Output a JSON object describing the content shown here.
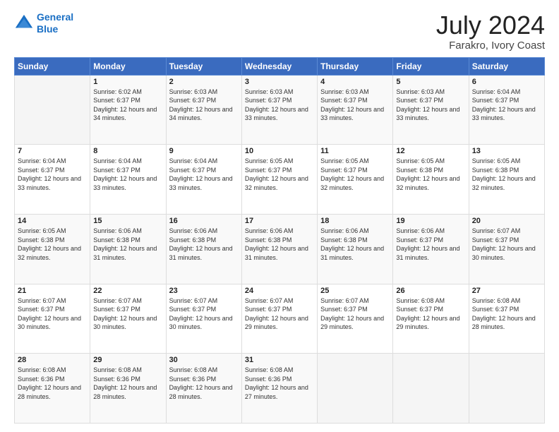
{
  "header": {
    "logo_line1": "General",
    "logo_line2": "Blue",
    "title": "July 2024",
    "subtitle": "Farakro, Ivory Coast"
  },
  "days_of_week": [
    "Sunday",
    "Monday",
    "Tuesday",
    "Wednesday",
    "Thursday",
    "Friday",
    "Saturday"
  ],
  "weeks": [
    [
      {
        "day": "",
        "sunrise": "",
        "sunset": "",
        "daylight": ""
      },
      {
        "day": "1",
        "sunrise": "Sunrise: 6:02 AM",
        "sunset": "Sunset: 6:37 PM",
        "daylight": "Daylight: 12 hours and 34 minutes."
      },
      {
        "day": "2",
        "sunrise": "Sunrise: 6:03 AM",
        "sunset": "Sunset: 6:37 PM",
        "daylight": "Daylight: 12 hours and 34 minutes."
      },
      {
        "day": "3",
        "sunrise": "Sunrise: 6:03 AM",
        "sunset": "Sunset: 6:37 PM",
        "daylight": "Daylight: 12 hours and 33 minutes."
      },
      {
        "day": "4",
        "sunrise": "Sunrise: 6:03 AM",
        "sunset": "Sunset: 6:37 PM",
        "daylight": "Daylight: 12 hours and 33 minutes."
      },
      {
        "day": "5",
        "sunrise": "Sunrise: 6:03 AM",
        "sunset": "Sunset: 6:37 PM",
        "daylight": "Daylight: 12 hours and 33 minutes."
      },
      {
        "day": "6",
        "sunrise": "Sunrise: 6:04 AM",
        "sunset": "Sunset: 6:37 PM",
        "daylight": "Daylight: 12 hours and 33 minutes."
      }
    ],
    [
      {
        "day": "7",
        "sunrise": "Sunrise: 6:04 AM",
        "sunset": "Sunset: 6:37 PM",
        "daylight": "Daylight: 12 hours and 33 minutes."
      },
      {
        "day": "8",
        "sunrise": "Sunrise: 6:04 AM",
        "sunset": "Sunset: 6:37 PM",
        "daylight": "Daylight: 12 hours and 33 minutes."
      },
      {
        "day": "9",
        "sunrise": "Sunrise: 6:04 AM",
        "sunset": "Sunset: 6:37 PM",
        "daylight": "Daylight: 12 hours and 33 minutes."
      },
      {
        "day": "10",
        "sunrise": "Sunrise: 6:05 AM",
        "sunset": "Sunset: 6:37 PM",
        "daylight": "Daylight: 12 hours and 32 minutes."
      },
      {
        "day": "11",
        "sunrise": "Sunrise: 6:05 AM",
        "sunset": "Sunset: 6:37 PM",
        "daylight": "Daylight: 12 hours and 32 minutes."
      },
      {
        "day": "12",
        "sunrise": "Sunrise: 6:05 AM",
        "sunset": "Sunset: 6:38 PM",
        "daylight": "Daylight: 12 hours and 32 minutes."
      },
      {
        "day": "13",
        "sunrise": "Sunrise: 6:05 AM",
        "sunset": "Sunset: 6:38 PM",
        "daylight": "Daylight: 12 hours and 32 minutes."
      }
    ],
    [
      {
        "day": "14",
        "sunrise": "Sunrise: 6:05 AM",
        "sunset": "Sunset: 6:38 PM",
        "daylight": "Daylight: 12 hours and 32 minutes."
      },
      {
        "day": "15",
        "sunrise": "Sunrise: 6:06 AM",
        "sunset": "Sunset: 6:38 PM",
        "daylight": "Daylight: 12 hours and 31 minutes."
      },
      {
        "day": "16",
        "sunrise": "Sunrise: 6:06 AM",
        "sunset": "Sunset: 6:38 PM",
        "daylight": "Daylight: 12 hours and 31 minutes."
      },
      {
        "day": "17",
        "sunrise": "Sunrise: 6:06 AM",
        "sunset": "Sunset: 6:38 PM",
        "daylight": "Daylight: 12 hours and 31 minutes."
      },
      {
        "day": "18",
        "sunrise": "Sunrise: 6:06 AM",
        "sunset": "Sunset: 6:38 PM",
        "daylight": "Daylight: 12 hours and 31 minutes."
      },
      {
        "day": "19",
        "sunrise": "Sunrise: 6:06 AM",
        "sunset": "Sunset: 6:37 PM",
        "daylight": "Daylight: 12 hours and 31 minutes."
      },
      {
        "day": "20",
        "sunrise": "Sunrise: 6:07 AM",
        "sunset": "Sunset: 6:37 PM",
        "daylight": "Daylight: 12 hours and 30 minutes."
      }
    ],
    [
      {
        "day": "21",
        "sunrise": "Sunrise: 6:07 AM",
        "sunset": "Sunset: 6:37 PM",
        "daylight": "Daylight: 12 hours and 30 minutes."
      },
      {
        "day": "22",
        "sunrise": "Sunrise: 6:07 AM",
        "sunset": "Sunset: 6:37 PM",
        "daylight": "Daylight: 12 hours and 30 minutes."
      },
      {
        "day": "23",
        "sunrise": "Sunrise: 6:07 AM",
        "sunset": "Sunset: 6:37 PM",
        "daylight": "Daylight: 12 hours and 30 minutes."
      },
      {
        "day": "24",
        "sunrise": "Sunrise: 6:07 AM",
        "sunset": "Sunset: 6:37 PM",
        "daylight": "Daylight: 12 hours and 29 minutes."
      },
      {
        "day": "25",
        "sunrise": "Sunrise: 6:07 AM",
        "sunset": "Sunset: 6:37 PM",
        "daylight": "Daylight: 12 hours and 29 minutes."
      },
      {
        "day": "26",
        "sunrise": "Sunrise: 6:08 AM",
        "sunset": "Sunset: 6:37 PM",
        "daylight": "Daylight: 12 hours and 29 minutes."
      },
      {
        "day": "27",
        "sunrise": "Sunrise: 6:08 AM",
        "sunset": "Sunset: 6:37 PM",
        "daylight": "Daylight: 12 hours and 28 minutes."
      }
    ],
    [
      {
        "day": "28",
        "sunrise": "Sunrise: 6:08 AM",
        "sunset": "Sunset: 6:36 PM",
        "daylight": "Daylight: 12 hours and 28 minutes."
      },
      {
        "day": "29",
        "sunrise": "Sunrise: 6:08 AM",
        "sunset": "Sunset: 6:36 PM",
        "daylight": "Daylight: 12 hours and 28 minutes."
      },
      {
        "day": "30",
        "sunrise": "Sunrise: 6:08 AM",
        "sunset": "Sunset: 6:36 PM",
        "daylight": "Daylight: 12 hours and 28 minutes."
      },
      {
        "day": "31",
        "sunrise": "Sunrise: 6:08 AM",
        "sunset": "Sunset: 6:36 PM",
        "daylight": "Daylight: 12 hours and 27 minutes."
      },
      {
        "day": "",
        "sunrise": "",
        "sunset": "",
        "daylight": ""
      },
      {
        "day": "",
        "sunrise": "",
        "sunset": "",
        "daylight": ""
      },
      {
        "day": "",
        "sunrise": "",
        "sunset": "",
        "daylight": ""
      }
    ]
  ]
}
